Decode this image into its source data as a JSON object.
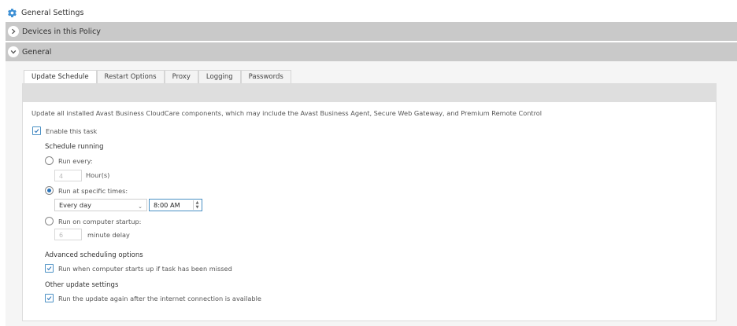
{
  "header": {
    "title": "General Settings",
    "icon": "gear-icon",
    "icon_color": "#3a8ed4"
  },
  "accordions": [
    {
      "label": "Devices in this Policy",
      "state": "collapsed",
      "icon": "chevron-right-icon"
    },
    {
      "label": "General",
      "state": "expanded",
      "icon": "chevron-down-icon"
    }
  ],
  "tabs": [
    {
      "label": "Update Schedule",
      "active": true
    },
    {
      "label": "Restart Options",
      "active": false
    },
    {
      "label": "Proxy",
      "active": false
    },
    {
      "label": "Logging",
      "active": false
    },
    {
      "label": "Passwords",
      "active": false
    }
  ],
  "content": {
    "description": "Update all installed Avast Business CloudCare components, which may include the Avast Business Agent, Secure Web Gateway, and Premium Remote Control",
    "enable_task": {
      "label": "Enable this task",
      "checked": true
    },
    "schedule_heading": "Schedule running",
    "run_every": {
      "label": "Run every:",
      "selected": false,
      "value": "4",
      "unit": "Hour(s)"
    },
    "run_specific": {
      "label": "Run at specific times:",
      "selected": true,
      "frequency": "Every day",
      "time": "8:00 AM"
    },
    "run_startup": {
      "label": "Run on computer startup:",
      "selected": false,
      "value": "6",
      "unit": "minute delay"
    },
    "advanced_heading": "Advanced scheduling options",
    "run_missed": {
      "label": "Run when computer starts up if task has been missed",
      "checked": true
    },
    "other_heading": "Other update settings",
    "run_again": {
      "label": "Run the update again after the internet connection is available",
      "checked": true
    }
  },
  "colors": {
    "accent": "#2a73b8",
    "accordion_bg": "#c9c9c9",
    "panel_bg": "#f5f5f5"
  }
}
